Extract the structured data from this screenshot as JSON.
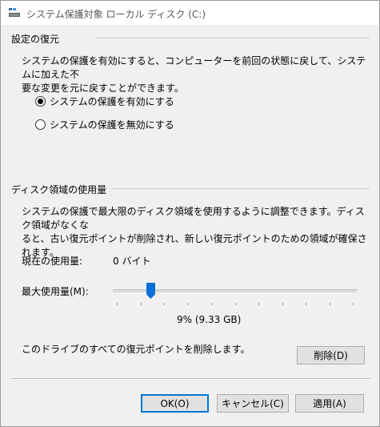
{
  "window": {
    "title": "システム保護対象 ローカル ディスク (C:)"
  },
  "restore_settings": {
    "header": "設定の復元",
    "description_line1": "システムの保護を有効にすると、コンピューターを前回の状態に戻して、システムに加えた不",
    "description_line2": "要な変更を元に戻すことができます。",
    "options": [
      {
        "label": "システムの保護を有効にする",
        "checked": true
      },
      {
        "label": "システムの保護を無効にする",
        "checked": false
      }
    ]
  },
  "disk_usage": {
    "header": "ディスク領域の使用量",
    "description_line1": "システムの保護で最大限のディスク領域を使用するように調整できます。ディスク領域がなくな",
    "description_line2": "ると、古い復元ポイントが削除され、新しい復元ポイントのための領域が確保されます。",
    "current_usage_label": "現在の使用量:",
    "current_usage_value": "0 バイト",
    "max_usage_label": "最大使用量(M):",
    "max_usage_fraction": 0.09,
    "max_usage_display": "9% (9.33 GB)",
    "delete_text": "このドライブのすべての復元ポイントを削除します。",
    "delete_button": "削除(D)"
  },
  "buttons": {
    "ok": "OK(O)",
    "cancel": "キャンセル(C)",
    "apply": "適用(A)"
  },
  "colors": {
    "accent": "#0a6fd6",
    "default_button_border": "#0078d7"
  }
}
